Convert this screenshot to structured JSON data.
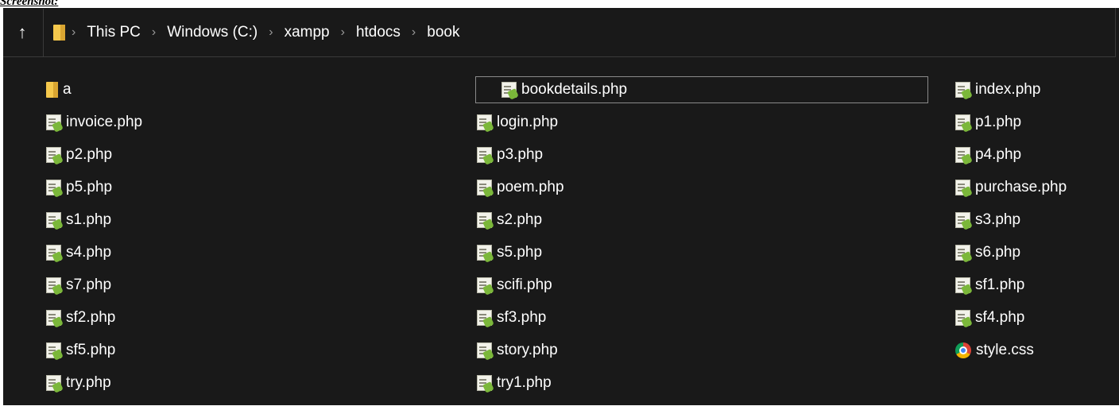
{
  "caption": "Screenshot:",
  "address_bar": {
    "up_icon": "arrow-up-icon",
    "folder_icon": "folder-icon",
    "breadcrumb": [
      "This PC",
      "Windows (C:)",
      "xampp",
      "htdocs",
      "book"
    ]
  },
  "files": [
    {
      "name": "a",
      "type": "folder"
    },
    {
      "name": "invoice.php",
      "type": "php"
    },
    {
      "name": "p2.php",
      "type": "php"
    },
    {
      "name": "p5.php",
      "type": "php"
    },
    {
      "name": "s1.php",
      "type": "php"
    },
    {
      "name": "s4.php",
      "type": "php"
    },
    {
      "name": "s7.php",
      "type": "php"
    },
    {
      "name": "sf2.php",
      "type": "php"
    },
    {
      "name": "sf5.php",
      "type": "php"
    },
    {
      "name": "try.php",
      "type": "php"
    },
    {
      "name": "bookdetails.php",
      "type": "php",
      "selected": true
    },
    {
      "name": "login.php",
      "type": "php"
    },
    {
      "name": "p3.php",
      "type": "php"
    },
    {
      "name": "poem.php",
      "type": "php"
    },
    {
      "name": "s2.php",
      "type": "php"
    },
    {
      "name": "s5.php",
      "type": "php"
    },
    {
      "name": "scifi.php",
      "type": "php"
    },
    {
      "name": "sf3.php",
      "type": "php"
    },
    {
      "name": "story.php",
      "type": "php"
    },
    {
      "name": "try1.php",
      "type": "php"
    },
    {
      "name": "index.php",
      "type": "php"
    },
    {
      "name": "p1.php",
      "type": "php"
    },
    {
      "name": "p4.php",
      "type": "php"
    },
    {
      "name": "purchase.php",
      "type": "php"
    },
    {
      "name": "s3.php",
      "type": "php"
    },
    {
      "name": "s6.php",
      "type": "php"
    },
    {
      "name": "sf1.php",
      "type": "php"
    },
    {
      "name": "sf4.php",
      "type": "php"
    },
    {
      "name": "style.css",
      "type": "css"
    }
  ]
}
